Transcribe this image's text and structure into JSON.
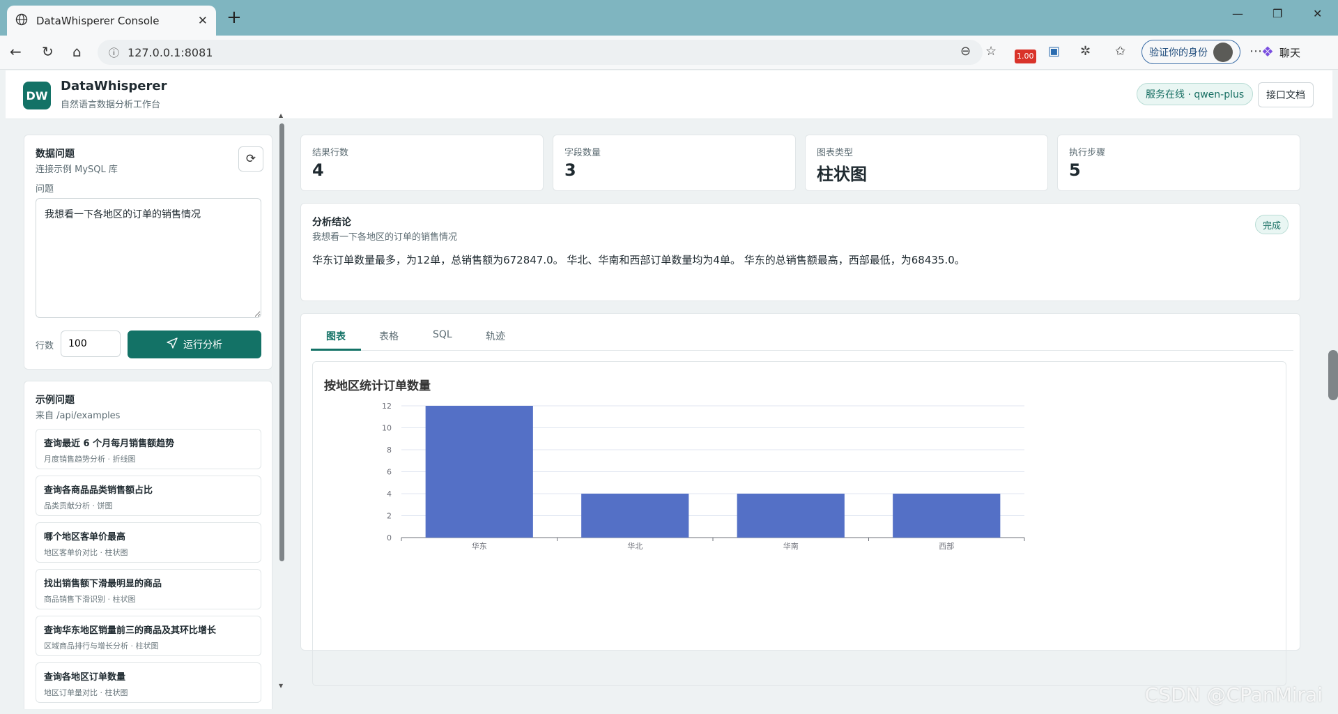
{
  "browser": {
    "tab_title": "DataWhisperer Console",
    "url": "127.0.0.1:8081",
    "badge_text": "1.00",
    "verify_label": "验证你的身份",
    "chat_label": "聊天"
  },
  "header": {
    "logo": "DW",
    "brand": "DataWhisperer",
    "subtitle": "自然语言数据分析工作台",
    "status": "服务在线 · qwen-plus",
    "api_doc": "接口文档"
  },
  "question_panel": {
    "title": "数据问题",
    "subtitle": "连接示例 MySQL 库",
    "question_label": "问题",
    "question_value": "我想看一下各地区的订单的销售情况",
    "rows_label": "行数",
    "rows_value": "100",
    "run_label": "运行分析"
  },
  "examples": {
    "title": "示例问题",
    "subtitle": "来自 /api/examples",
    "items": [
      {
        "title": "查询最近 6 个月每月销售额趋势",
        "desc": "月度销售趋势分析 · 折线图"
      },
      {
        "title": "查询各商品品类销售额占比",
        "desc": "品类贡献分析 · 饼图"
      },
      {
        "title": "哪个地区客单价最高",
        "desc": "地区客单价对比 · 柱状图"
      },
      {
        "title": "找出销售额下滑最明显的商品",
        "desc": "商品销售下滑识别 · 柱状图"
      },
      {
        "title": "查询华东地区销量前三的商品及其环比增长",
        "desc": "区域商品排行与增长分析 · 柱状图"
      },
      {
        "title": "查询各地区订单数量",
        "desc": "地区订单量对比 · 柱状图"
      }
    ]
  },
  "stats": [
    {
      "label": "结果行数",
      "value": "4"
    },
    {
      "label": "字段数量",
      "value": "3"
    },
    {
      "label": "图表类型",
      "value": "柱状图"
    },
    {
      "label": "执行步骤",
      "value": "5"
    }
  ],
  "analysis": {
    "title": "分析结论",
    "subtitle": "我想看一下各地区的订单的销售情况",
    "status": "完成",
    "text": "华东订单数量最多，为12单，总销售额为672847.0。 华北、华南和西部订单数量均为4单。 华东的总销售额最高，西部最低，为68435.0。"
  },
  "result_tabs": [
    "图表",
    "表格",
    "SQL",
    "轨迹"
  ],
  "watermark": "CSDN @CPanMirai",
  "colors": {
    "accent": "#137266",
    "bar": "#5470c6"
  },
  "chart_data": {
    "type": "bar",
    "title": "按地区统计订单数量",
    "categories": [
      "华东",
      "华北",
      "华南",
      "西部"
    ],
    "values": [
      12,
      4,
      4,
      4
    ],
    "ylim": [
      0,
      12
    ],
    "yticks": [
      0,
      2,
      4,
      6,
      8,
      10,
      12
    ],
    "grid": true,
    "xlabel": "",
    "ylabel": ""
  }
}
